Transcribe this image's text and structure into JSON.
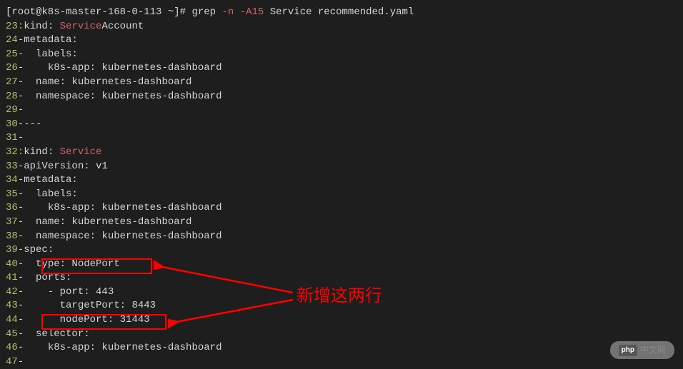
{
  "prompt": "[root@k8s-master-168-0-113 ~]# ",
  "command": {
    "cmd": "grep ",
    "flag1": "-n",
    "flag2": "-A15",
    "args": " Service recommended.yaml"
  },
  "lines": [
    {
      "num": "23",
      "sep": ":",
      "pre": "kind: ",
      "hl": "Service",
      "post": "Account"
    },
    {
      "num": "24",
      "sep": "-",
      "pre": "metadata:"
    },
    {
      "num": "25",
      "sep": "-",
      "pre": "  labels:"
    },
    {
      "num": "26",
      "sep": "-",
      "pre": "    k8s-app: kubernetes-dashboard"
    },
    {
      "num": "27",
      "sep": "-",
      "pre": "  name: kubernetes-dashboard"
    },
    {
      "num": "28",
      "sep": "-",
      "pre": "  namespace: kubernetes-dashboard"
    },
    {
      "num": "29",
      "sep": "-",
      "pre": ""
    },
    {
      "num": "30",
      "sep": "-",
      "pre": "---"
    },
    {
      "num": "31",
      "sep": "-",
      "pre": ""
    },
    {
      "num": "32",
      "sep": ":",
      "pre": "kind: ",
      "hl": "Service",
      "post": ""
    },
    {
      "num": "33",
      "sep": "-",
      "pre": "apiVersion: v1"
    },
    {
      "num": "34",
      "sep": "-",
      "pre": "metadata:"
    },
    {
      "num": "35",
      "sep": "-",
      "pre": "  labels:"
    },
    {
      "num": "36",
      "sep": "-",
      "pre": "    k8s-app: kubernetes-dashboard"
    },
    {
      "num": "37",
      "sep": "-",
      "pre": "  name: kubernetes-dashboard"
    },
    {
      "num": "38",
      "sep": "-",
      "pre": "  namespace: kubernetes-dashboard"
    },
    {
      "num": "39",
      "sep": "-",
      "pre": "spec:"
    },
    {
      "num": "40",
      "sep": "-",
      "pre": "  type: NodePort"
    },
    {
      "num": "41",
      "sep": "-",
      "pre": "  ports:"
    },
    {
      "num": "42",
      "sep": "-",
      "pre": "    - port: 443"
    },
    {
      "num": "43",
      "sep": "-",
      "pre": "      targetPort: 8443"
    },
    {
      "num": "44",
      "sep": "-",
      "pre": "      nodePort: 31443"
    },
    {
      "num": "45",
      "sep": "-",
      "pre": "  selector:"
    },
    {
      "num": "46",
      "sep": "-",
      "pre": "    k8s-app: kubernetes-dashboard"
    },
    {
      "num": "47",
      "sep": "-",
      "pre": ""
    }
  ],
  "annotation": "新增这两行",
  "watermark": {
    "logo": "php",
    "text": "中文网"
  }
}
